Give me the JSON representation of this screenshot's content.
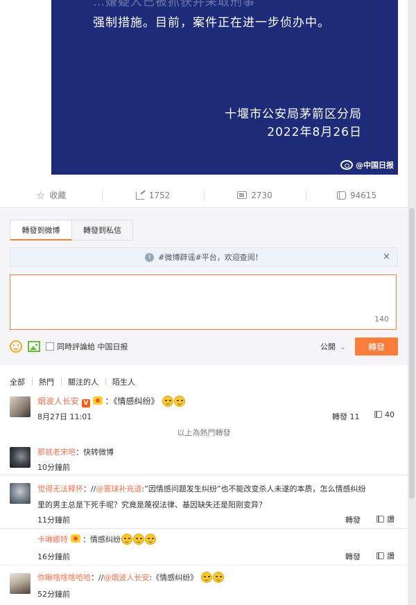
{
  "poster": {
    "line_partial": "…嫌疑人已被抓获并采取刑事",
    "line2": "强制措施。目前，案件正在进一步侦办中。",
    "org": "十堰市公安局茅箭区分局",
    "date": "2022年8月26日",
    "watermark": "@中国日报"
  },
  "actions": {
    "favorite": "收藏",
    "forward_count": "1752",
    "comment_count": "2730",
    "like_count": "94615"
  },
  "forward_panel": {
    "tab_weibo": "轉發到微博",
    "tab_dm": "轉發到私信",
    "notice": "#微博辟谣#平台，欢迎查阅！",
    "close": "×",
    "counter": "140",
    "sync_label": "同時評論給 中国日报",
    "visibility": "公開",
    "send": "轉發"
  },
  "filters": [
    "全部",
    "熱門",
    "關注的人",
    "陌生人"
  ],
  "hot_separator": "以上為熱門轉發",
  "reposts": [
    {
      "user": "烟波人长安",
      "text": "：《情感纠纷》",
      "time": "8月27日 11:01",
      "forward": "轉發 11",
      "likes": "40"
    },
    {
      "user": "那就老宋吧",
      "text": "：快转微博",
      "time": "10分鐘前"
    },
    {
      "user": "觉得无法释怀",
      "text_a": "：//",
      "mention": "@寰球补充道",
      "text_b": ":”因情感问题发生纠纷”也不能改变杀人未遂的本质，怎么情感纠纷",
      "text_line2": "里的男主总是下死手呢？究竟是蔑视法律、基因缺失还是阳刚变异？",
      "time": "11分鐘前",
      "forward": "轉發",
      "likes": "讚"
    },
    {
      "user": "卡琳娜特",
      "text": "：情感纠纷",
      "time": "16分鐘前",
      "forward": "轉發",
      "likes": "讚"
    },
    {
      "user": "你瞅啥啥啥哈哈",
      "text_a": "：//",
      "mention": "@烟波人长安",
      "text_b": ":《情感纠纷》",
      "time": "52分鐘前"
    }
  ],
  "colors": {
    "accent": "#fa7d3c",
    "username": "#eb7350",
    "poster_bg": "#1e2b78"
  }
}
